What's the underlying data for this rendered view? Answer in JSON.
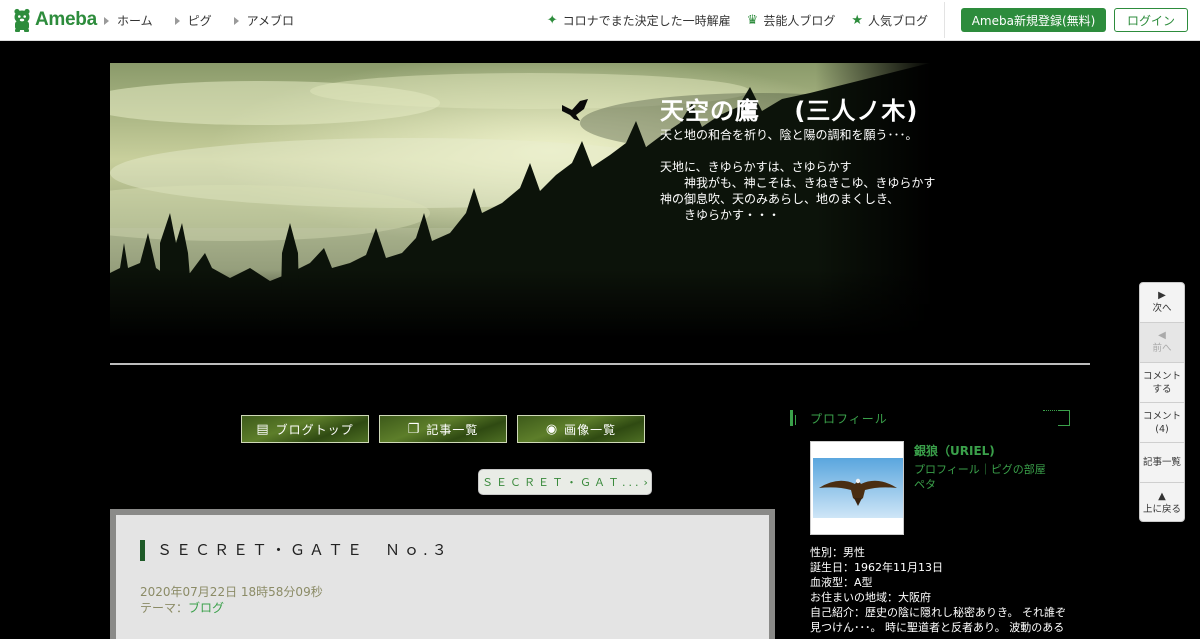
{
  "header": {
    "logo_text": "Ameba",
    "nav": [
      {
        "label": "ホーム"
      },
      {
        "label": "ピグ"
      },
      {
        "label": "アメブロ"
      }
    ],
    "right_links": [
      {
        "icon": "sparkle-icon",
        "label": "コロナでまた決定した一時解雇"
      },
      {
        "icon": "crown-icon",
        "label": "芸能人ブログ"
      },
      {
        "icon": "star-icon",
        "label": "人気ブログ"
      }
    ],
    "register_label": "Ameba新規登録(無料)",
    "login_label": "ログイン"
  },
  "blog": {
    "title": "天空の鷹　 (三人ノ木)",
    "description": "天と地の和合を祈り、陰と陽の調和を願う･･･。\n\n天地に、きゆらかすは、さゆらかす\n　　神我がも、神こそは、きねきこゆ、きゆらかす\n神の御息吹、天のみあらし、地のまくしき、\n　　きゆらかす・・・"
  },
  "blog_nav": [
    {
      "icon": "document-icon",
      "label": "ブログトップ"
    },
    {
      "icon": "copy-icon",
      "label": "記事一覧"
    },
    {
      "icon": "camera-icon",
      "label": "画像一覧"
    }
  ],
  "prev_entry_label": "ＳＥＣＲＥＴ・ＧＡＴ...",
  "entry": {
    "title": "ＳＥＣＲＥＴ・ＧＡＴＥ　Ｎｏ.３",
    "date": "2020年07月22日 18時58分09秒",
    "theme_prefix": "テーマ：",
    "theme_link": "ブログ"
  },
  "sidebar": {
    "heading": "プロフィール",
    "name": "銀狼（URIEL)",
    "links": "プロフィール｜ピグの部屋",
    "beta": "ペタ",
    "info": [
      "性別：男性",
      "誕生日：1962年11月13日",
      "血液型：A型",
      "お住まいの地域：大阪府",
      "自己紹介：歴史の陰に隠れし秘密ありき。 それ誰ぞ",
      "見つけん･･･。 時に聖道者と反者あり。 波動のある"
    ]
  },
  "pager": [
    {
      "icon": "▶",
      "label": "次へ",
      "enabled": true
    },
    {
      "icon": "◀",
      "label": "前へ",
      "enabled": false
    },
    {
      "icon": "",
      "label": "コメント\nする",
      "enabled": true
    },
    {
      "icon": "",
      "label": "コメント\n(4)",
      "enabled": true
    },
    {
      "icon": "",
      "label": "記事一覧",
      "enabled": true
    },
    {
      "icon": "▲",
      "label": "上に戻る",
      "enabled": true
    }
  ],
  "colors": {
    "brand": "#2d8c3c",
    "accent_green": "#3aa04a",
    "background": "#000000"
  }
}
